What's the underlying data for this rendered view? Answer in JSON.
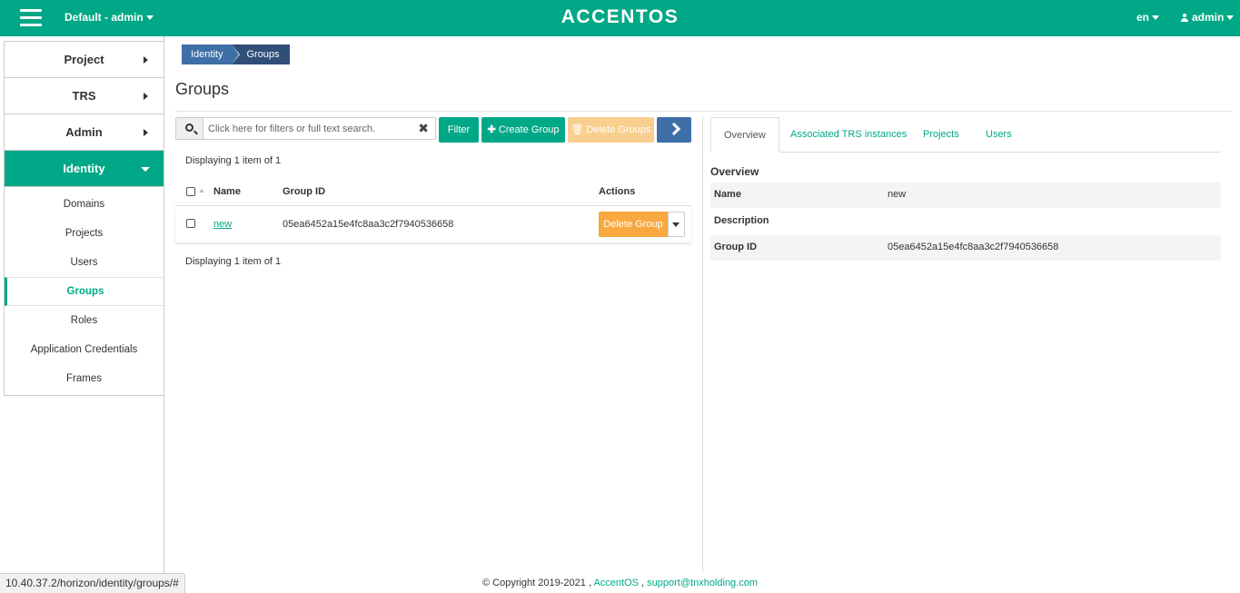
{
  "header": {
    "project_switch": "Default - admin",
    "brand": "ACCENTOS",
    "language": "en",
    "user": "admin"
  },
  "sidebar": {
    "items": [
      {
        "label": "Project"
      },
      {
        "label": "TRS"
      },
      {
        "label": "Admin"
      },
      {
        "label": "Identity"
      }
    ],
    "subitems": [
      {
        "label": "Domains"
      },
      {
        "label": "Projects"
      },
      {
        "label": "Users"
      },
      {
        "label": "Groups"
      },
      {
        "label": "Roles"
      },
      {
        "label": "Application Credentials"
      },
      {
        "label": "Frames"
      }
    ]
  },
  "breadcrumb": [
    "Identity",
    "Groups"
  ],
  "page_title": "Groups",
  "toolbar": {
    "search_placeholder": "Click here for filters or full text search.",
    "filter_label": "Filter",
    "create_label": "Create Group",
    "delete_label": "Delete Groups"
  },
  "table": {
    "count_text": "Displaying 1 item of 1",
    "headers": {
      "name": "Name",
      "group_id": "Group ID",
      "actions": "Actions"
    },
    "rows": [
      {
        "name": "new",
        "group_id": "05ea6452a15e4fc8aa3c2f7940536658",
        "action": "Delete Group"
      }
    ]
  },
  "detail": {
    "tabs": [
      "Overview",
      "Associated TRS instances",
      "Projects",
      "Users"
    ],
    "section_title": "Overview",
    "fields": [
      {
        "label": "Name",
        "value": "new"
      },
      {
        "label": "Description",
        "value": ""
      },
      {
        "label": "Group ID",
        "value": "05ea6452a15e4fc8aa3c2f7940536658"
      }
    ]
  },
  "footer": {
    "copyright": "© Copyright 2019-2021 ,",
    "product_link": "AccentOS",
    "separator": ",",
    "support_link": "support@tnxholding.com"
  },
  "statusbar": "10.40.37.2/horizon/identity/groups/#",
  "colors": {
    "primary": "#00a887",
    "breadcrumb": "#3f6fa7",
    "warning": "#f7a940"
  }
}
